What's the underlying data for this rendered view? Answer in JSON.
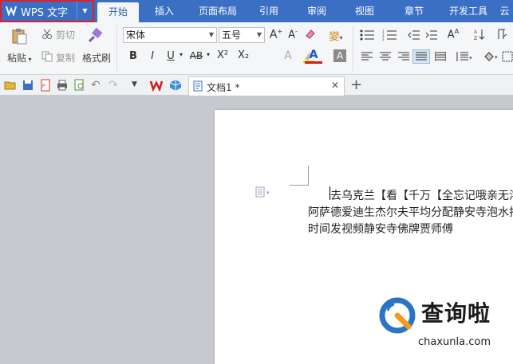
{
  "app": {
    "title": "WPS 文字"
  },
  "tabs": [
    "开始",
    "插入",
    "页面布局",
    "引用",
    "审阅",
    "视图",
    "章节",
    "开发工具",
    "云"
  ],
  "ribbon": {
    "paste": "粘贴",
    "cut": "剪切",
    "copy": "复制",
    "format_painter": "格式刷",
    "font_name": "宋体",
    "font_size": "五号",
    "bold": "B",
    "italic": "I",
    "underline": "U",
    "strike": "AB",
    "superscript": "X²",
    "subscript": "X₂"
  },
  "document": {
    "tab_label": "文档1 *",
    "lines": [
      "去乌克兰【看【千万【全忘记哦亲无溶",
      "阿萨德爱迪生杰尔夫平均分配静安寺泡水排",
      "时间发视频静安寺佛牌贾师傅"
    ]
  },
  "watermark": {
    "title": "查询啦",
    "url": "chaxunla.com"
  },
  "colors": {
    "accent": "#3a6fc4",
    "highlight": "#e01e2a",
    "font_color": "#1e4fd0",
    "highlight_color": "#f3d400"
  }
}
